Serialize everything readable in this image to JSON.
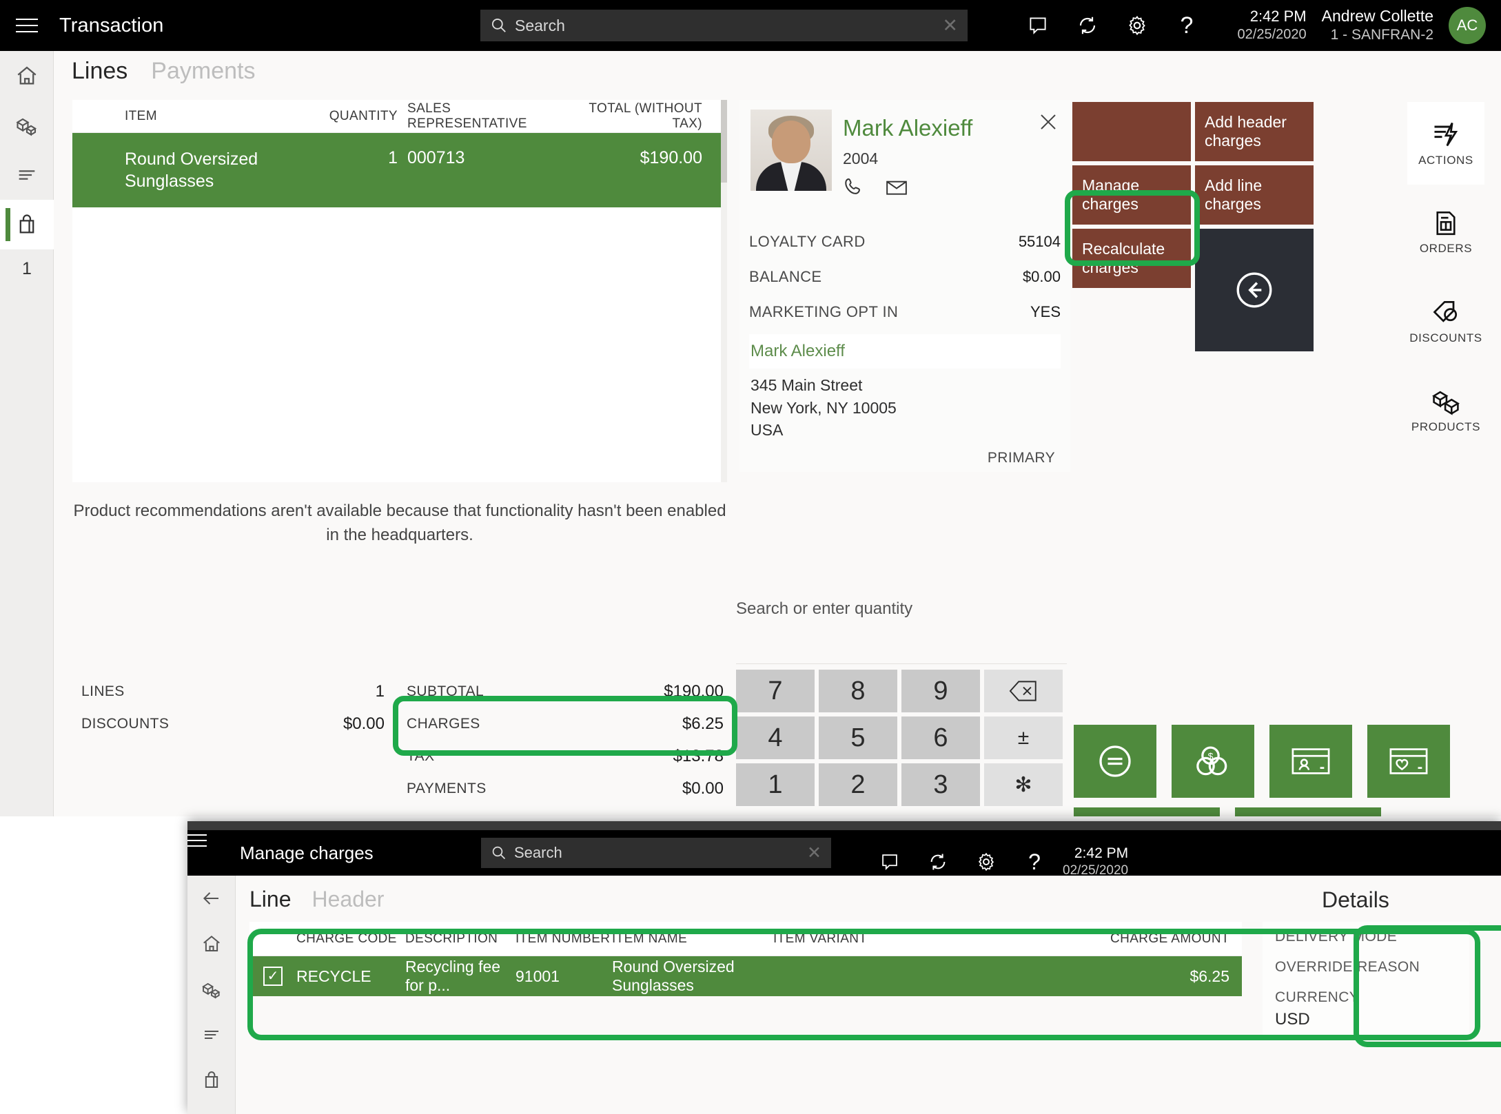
{
  "main_window": {
    "topbar": {
      "menu_icon": "hamburger-icon",
      "title": "Transaction",
      "search_placeholder": "Search",
      "search_value": "",
      "clear_icon": "close-icon",
      "icons": [
        "note-icon",
        "sync-icon",
        "gear-icon",
        "help-icon"
      ],
      "time": "2:42 PM",
      "date": "02/25/2020",
      "user_name": "Andrew Collette",
      "user_store": "1 - SANFRAN-2",
      "avatar_initials": "AC"
    },
    "left_rail": {
      "items": [
        "home-icon",
        "products-icon",
        "list-icon",
        "cart-icon"
      ],
      "active_index": 3,
      "count": "1"
    },
    "tabs": [
      {
        "label": "Lines",
        "active": true
      },
      {
        "label": "Payments",
        "active": false
      }
    ],
    "lines_grid": {
      "columns": [
        "ITEM",
        "QUANTITY",
        "SALES REPRESENTATIVE",
        "TOTAL (WITHOUT TAX)"
      ],
      "rows": [
        {
          "item": "Round Oversized Sunglasses",
          "quantity": "1",
          "sales_representative": "000713",
          "total_without_tax": "$190.00",
          "selected": true
        }
      ]
    },
    "recommendation_note": "Product recommendations aren't available because that functionality hasn't been enabled in the headquarters.",
    "totals_left": [
      {
        "label": "LINES",
        "value": "1"
      },
      {
        "label": "DISCOUNTS",
        "value": "$0.00"
      }
    ],
    "totals_right": [
      {
        "label": "SUBTOTAL",
        "value": "$190.00"
      },
      {
        "label": "CHARGES",
        "value": "$6.25"
      },
      {
        "label": "TAX",
        "value": "$13.78"
      },
      {
        "label": "PAYMENTS",
        "value": "$0.00"
      }
    ],
    "customer_card": {
      "name": "Mark Alexieff",
      "customer_id": "2004",
      "phone_icon": "phone-icon",
      "email_icon": "mail-icon",
      "close_icon": "close-icon",
      "fields": [
        {
          "label": "LOYALTY CARD",
          "value": "55104"
        },
        {
          "label": "BALANCE",
          "value": "$0.00"
        },
        {
          "label": "MARKETING OPT IN",
          "value": "YES"
        }
      ],
      "address_name": "Mark Alexieff",
      "address_lines": [
        "345 Main Street",
        "New York, NY 10005",
        "USA"
      ],
      "address_tag": "PRIMARY"
    },
    "action_tiles": [
      {
        "label": "",
        "kind": "brown",
        "name": "blank-tile-1"
      },
      {
        "label": "Add header charges",
        "kind": "brown",
        "name": "add-header-charges-tile"
      },
      {
        "label": "Manage charges",
        "kind": "brown",
        "name": "manage-charges-tile"
      },
      {
        "label": "Add line charges",
        "kind": "brown",
        "name": "add-line-charges-tile"
      },
      {
        "label": "Recalculate charges",
        "kind": "brown",
        "name": "recalculate-charges-tile"
      },
      {
        "label": "",
        "kind": "dark",
        "name": "back-tile"
      }
    ],
    "right_rail": [
      {
        "label": "ACTIONS",
        "icon": "actions-icon",
        "active": true
      },
      {
        "label": "ORDERS",
        "icon": "orders-icon",
        "active": false
      },
      {
        "label": "DISCOUNTS",
        "icon": "discounts-icon",
        "active": false
      },
      {
        "label": "PRODUCTS",
        "icon": "products-icon",
        "active": false
      }
    ],
    "quantity_hint": "Search or enter quantity",
    "keypad": [
      "7",
      "8",
      "9",
      "backspace-icon",
      "4",
      "5",
      "6",
      "±",
      "1",
      "2",
      "3",
      "✻"
    ],
    "payment_tiles": [
      {
        "icon": "exact-amount-icon",
        "name": "exact-amount-button"
      },
      {
        "icon": "cash-icon",
        "name": "cash-button"
      },
      {
        "icon": "customer-card-icon",
        "name": "customer-card-button"
      },
      {
        "icon": "gift-card-icon",
        "name": "gift-card-button"
      }
    ]
  },
  "dialog": {
    "topbar": {
      "menu_icon": "hamburger-icon",
      "title": "Manage charges",
      "search_placeholder": "Search",
      "clear_icon": "close-icon",
      "icons": [
        "note-icon",
        "sync-icon",
        "gear-icon",
        "help-icon"
      ],
      "time": "2:42 PM",
      "date": "02/25/2020"
    },
    "left_rail": [
      "back-arrow-icon",
      "home-icon",
      "products-icon",
      "list-icon",
      "cart-icon"
    ],
    "tabs": [
      {
        "label": "Line",
        "active": true
      },
      {
        "label": "Header",
        "active": false
      }
    ],
    "details_title": "Details",
    "charges_grid": {
      "columns": [
        "CHARGE CODE",
        "DESCRIPTION",
        "ITEM NUMBER",
        "ITEM NAME",
        "ITEM VARIANT",
        "CHARGE AMOUNT"
      ],
      "rows": [
        {
          "checked": true,
          "charge_code": "RECYCLE",
          "description": "Recycling fee for p...",
          "item_number": "91001",
          "item_name": "Round Oversized Sunglasses",
          "item_variant": "",
          "charge_amount": "$6.25",
          "selected": true
        }
      ]
    },
    "details": [
      {
        "label": "DELIVERY MODE",
        "value": ""
      },
      {
        "label": "OVERRIDE REASON",
        "value": ""
      },
      {
        "label": "CURRENCY",
        "value": "USD"
      }
    ]
  },
  "annotations": {
    "highlight_color": "#1fa94a",
    "regions": [
      "manage-charges-tile",
      "charges-total-row",
      "charges-grid-row",
      "details-panel"
    ]
  }
}
